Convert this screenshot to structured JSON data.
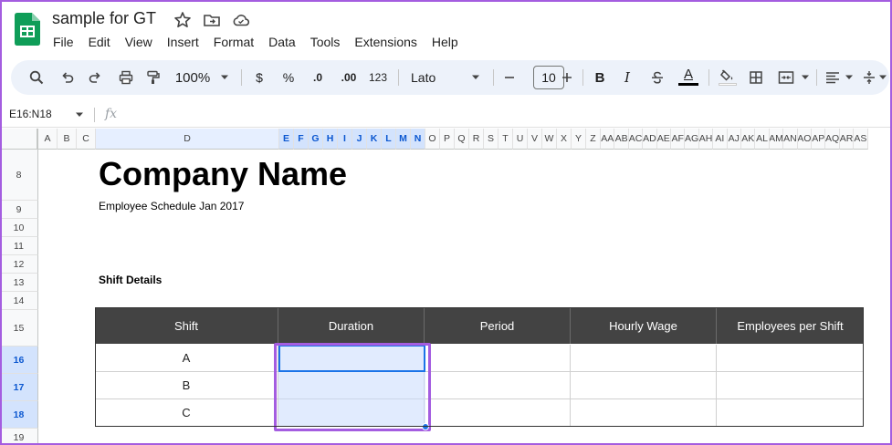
{
  "document": {
    "title": "sample for GT"
  },
  "menu": [
    "File",
    "Edit",
    "View",
    "Insert",
    "Format",
    "Data",
    "Tools",
    "Extensions",
    "Help"
  ],
  "toolbar": {
    "zoom": "100%",
    "currency": "$",
    "percent": "%",
    "decrease_decimal": ".0",
    "increase_decimal": ".00",
    "number_format": "123",
    "font": "Lato",
    "font_size": "10",
    "bold": "B",
    "italic": "I",
    "text_color_letter": "A"
  },
  "formula_bar": {
    "name_box": "E16:N18",
    "fx": "fx"
  },
  "columns": [
    "A",
    "B",
    "C",
    "D",
    "E",
    "F",
    "G",
    "H",
    "I",
    "J",
    "K",
    "L",
    "M",
    "N",
    "O",
    "P",
    "Q",
    "R",
    "S",
    "T",
    "U",
    "V",
    "W",
    "X",
    "Y",
    "Z",
    "AA",
    "AB",
    "AC",
    "AD",
    "AE",
    "AF",
    "AG",
    "AH",
    "AI",
    "AJ",
    "AK",
    "AL",
    "AM",
    "AN",
    "AO",
    "AP",
    "AQ",
    "AR",
    "AS"
  ],
  "rows": [
    "8",
    "9",
    "10",
    "11",
    "12",
    "13",
    "14",
    "15",
    "16",
    "17",
    "18",
    "19"
  ],
  "sheet": {
    "company_name": "Company Name",
    "subtitle": "Employee Schedule Jan 2017",
    "section_label": "Shift Details",
    "table": {
      "headers": [
        "Shift",
        "Duration",
        "Period",
        "Hourly Wage",
        "Employees per Shift"
      ],
      "rows": [
        [
          "A",
          "",
          "",
          "",
          ""
        ],
        [
          "B",
          "",
          "",
          "",
          ""
        ],
        [
          "C",
          "",
          "",
          "",
          ""
        ]
      ]
    }
  },
  "colors": {
    "accent": "#a45de0",
    "selection": "#1a73e8",
    "header_fill": "#434343",
    "logo": "#0f9d58"
  }
}
